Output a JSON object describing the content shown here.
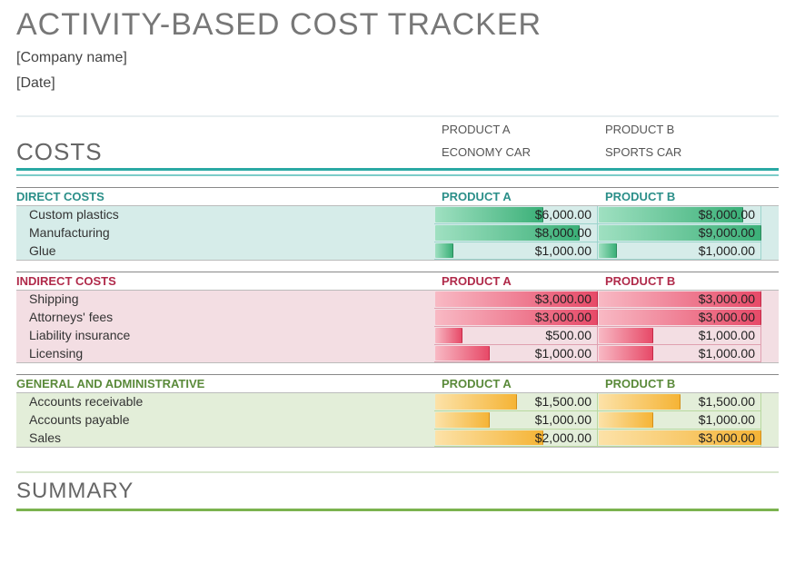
{
  "header": {
    "title": "ACTIVITY-BASED COST TRACKER",
    "company": "[Company name]",
    "date": "[Date]",
    "colhdr_a": "PRODUCT A",
    "colhdr_b": "PRODUCT B",
    "costs_label": "COSTS",
    "sub_a": "ECONOMY CAR",
    "sub_b": "SPORTS CAR",
    "summary": "SUMMARY"
  },
  "direct": {
    "title": "DIRECT COSTS",
    "col_a": "PRODUCT A",
    "col_b": "PRODUCT B",
    "rows": [
      {
        "label": "Custom plastics",
        "a": "$6,000.00",
        "b": "$8,000.00",
        "aw": 66.7,
        "bw": 88.9
      },
      {
        "label": "Manufacturing",
        "a": "$8,000.00",
        "b": "$9,000.00",
        "aw": 88.9,
        "bw": 100
      },
      {
        "label": "Glue",
        "a": "$1,000.00",
        "b": "$1,000.00",
        "aw": 11.1,
        "bw": 11.1
      }
    ]
  },
  "indirect": {
    "title": "INDIRECT COSTS",
    "col_a": "PRODUCT A",
    "col_b": "PRODUCT B",
    "rows": [
      {
        "label": "Shipping",
        "a": "$3,000.00",
        "b": "$3,000.00",
        "aw": 100,
        "bw": 100
      },
      {
        "label": "Attorneys' fees",
        "a": "$3,000.00",
        "b": "$3,000.00",
        "aw": 100,
        "bw": 100
      },
      {
        "label": "Liability insurance",
        "a": "$500.00",
        "b": "$1,000.00",
        "aw": 16.7,
        "bw": 33.3
      },
      {
        "label": "Licensing",
        "a": "$1,000.00",
        "b": "$1,000.00",
        "aw": 33.3,
        "bw": 33.3
      }
    ]
  },
  "ga": {
    "title": "GENERAL AND ADMINISTRATIVE",
    "col_a": "PRODUCT A",
    "col_b": "PRODUCT B",
    "rows": [
      {
        "label": "Accounts receivable",
        "a": "$1,500.00",
        "b": "$1,500.00",
        "aw": 50,
        "bw": 50
      },
      {
        "label": "Accounts payable",
        "a": "$1,000.00",
        "b": "$1,000.00",
        "aw": 33.3,
        "bw": 33.3
      },
      {
        "label": "Sales",
        "a": "$2,000.00",
        "b": "$3,000.00",
        "aw": 66.7,
        "bw": 100
      }
    ]
  }
}
